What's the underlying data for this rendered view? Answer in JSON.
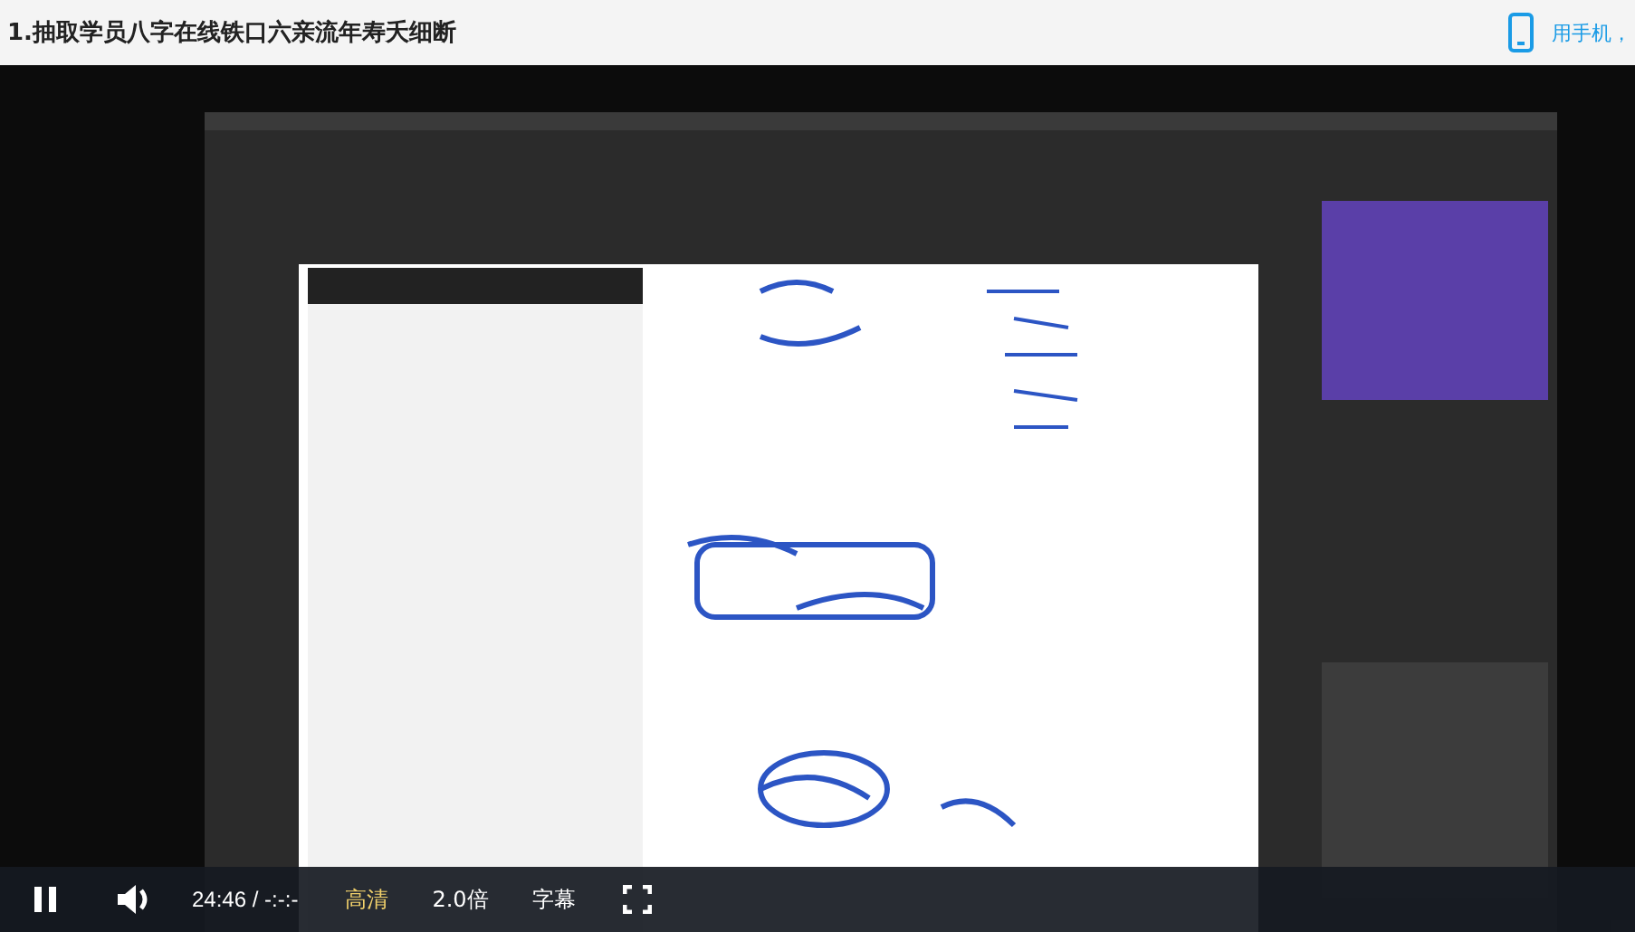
{
  "page": {
    "title": "1.抽取学员八字在线铁口六亲流年寿夭细断",
    "phone_link": "用手机，"
  },
  "player": {
    "playing": true,
    "time": "24:46 / -:-:-",
    "buttons": [
      {
        "label": "高清",
        "selected": true
      },
      {
        "label": "2.0倍",
        "selected": false
      },
      {
        "label": "字幕",
        "selected": false
      }
    ]
  }
}
